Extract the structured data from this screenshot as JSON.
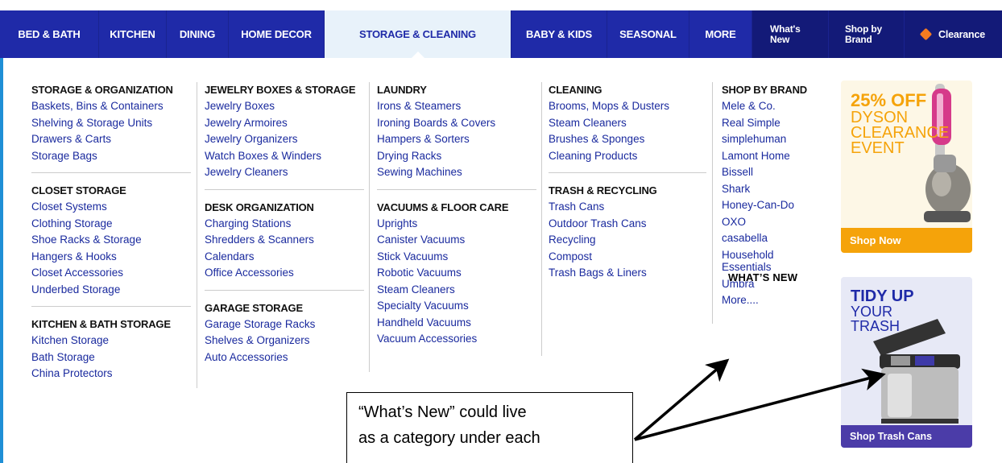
{
  "nav": {
    "items": [
      "BED & BATH",
      "KITCHEN",
      "DINING",
      "HOME DECOR",
      "STORAGE & CLEANING",
      "BABY & KIDS",
      "SEASONAL",
      "MORE"
    ],
    "whats_new": [
      "What's",
      "New"
    ],
    "shop_by_brand": [
      "Shop by",
      "Brand"
    ],
    "clearance": "Clearance"
  },
  "menu": {
    "col1": {
      "h1": "STORAGE & ORGANIZATION",
      "l1": [
        "Baskets, Bins & Containers",
        "Shelving & Storage Units",
        "Drawers & Carts",
        "Storage Bags"
      ],
      "h2": "CLOSET STORAGE",
      "l2": [
        "Closet Systems",
        "Clothing Storage",
        "Shoe Racks & Storage",
        "Hangers & Hooks",
        "Closet Accessories",
        "Underbed Storage"
      ],
      "h3": "KITCHEN & BATH STORAGE",
      "l3": [
        "Kitchen Storage",
        "Bath Storage",
        "China Protectors"
      ]
    },
    "col2": {
      "h1": "JEWELRY BOXES & STORAGE",
      "l1": [
        "Jewelry Boxes",
        "Jewelry Armoires",
        "Jewelry Organizers",
        "Watch Boxes & Winders",
        "Jewelry Cleaners"
      ],
      "h2": "DESK ORGANIZATION",
      "l2": [
        "Charging Stations",
        "Shredders & Scanners",
        "Calendars",
        "Office Accessories"
      ],
      "h3": "GARAGE STORAGE",
      "l3": [
        "Garage Storage Racks",
        "Shelves & Organizers",
        "Auto Accessories"
      ]
    },
    "col3": {
      "h1": "LAUNDRY",
      "l1": [
        "Irons & Steamers",
        "Ironing Boards & Covers",
        "Hampers & Sorters",
        "Drying Racks",
        "Sewing Machines"
      ],
      "h2": "VACUUMS & FLOOR CARE",
      "l2": [
        "Uprights",
        "Canister Vacuums",
        "Stick Vacuums",
        "Robotic Vacuums",
        "Steam Cleaners",
        "Specialty Vacuums",
        "Handheld Vacuums",
        "Vacuum Accessories"
      ]
    },
    "col4": {
      "h1": "CLEANING",
      "l1": [
        "Brooms, Mops & Dusters",
        "Steam Cleaners",
        "Brushes & Sponges",
        "Cleaning Products"
      ],
      "h2": "TRASH & RECYCLING",
      "l2": [
        "Trash Cans",
        "Outdoor Trash Cans",
        "Recycling",
        "Compost",
        "Trash Bags & Liners"
      ]
    },
    "col5": {
      "h1": "SHOP BY BRAND",
      "l1": [
        "Mele & Co.",
        "Real Simple",
        "simplehuman",
        "Lamont Home",
        "Bissell",
        "Shark",
        "Honey-Can-Do",
        "OXO",
        "casabella"
      ],
      "multi": [
        "Household",
        "Essentials"
      ],
      "l2": [
        "Umbra",
        "More...."
      ]
    }
  },
  "promo1": {
    "line1": "25% OFF",
    "line2": "DYSON",
    "line3": "CLEARANCE",
    "line4": "EVENT",
    "button": "Shop Now"
  },
  "promo2": {
    "line1": "TIDY UP",
    "line2": "YOUR",
    "line3": "TRASH",
    "button": "Shop Trash Cans"
  },
  "annotation": {
    "label": "WHAT’S NEW",
    "callout_line1": "“What’s New” could live",
    "callout_line2": "as a category under each"
  },
  "colors": {
    "nav": "#1f2aa8",
    "link": "#1a2a9e",
    "accent": "#f5a30a",
    "panel_border": "#1f8fd6"
  }
}
